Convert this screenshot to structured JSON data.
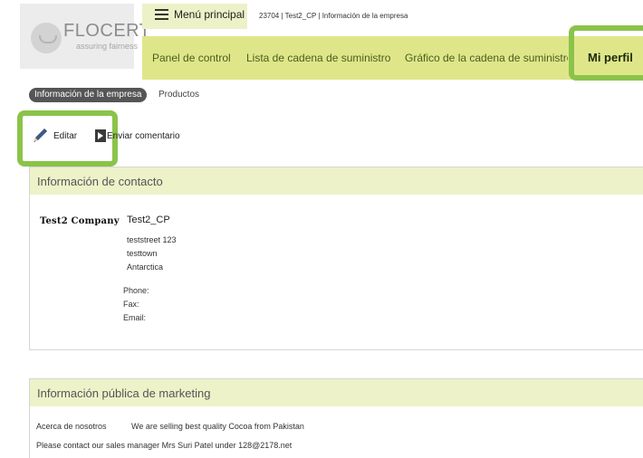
{
  "brand": {
    "name": "FLOCERT",
    "tagline": "assuring fairness"
  },
  "header": {
    "menu_label": "Menú principal",
    "breadcrumb": "23704 | Test2_CP | Información de la empresa"
  },
  "nav": {
    "items": [
      "Panel de control",
      "Lista de cadena de suministro",
      "Gráfico de la cadena de suministro"
    ],
    "active": "Mi perfil"
  },
  "tabs": {
    "active": "Información de la empresa",
    "other": "Productos"
  },
  "actions": {
    "edit": "Editar",
    "comment": "Enviar comentario"
  },
  "contact": {
    "title": "Información de contacto",
    "logo_text": "Test2 Company",
    "company": "Test2_CP",
    "address": [
      "teststreet 123",
      "testtown",
      "Antarctica"
    ],
    "phone_label": "Phone:",
    "fax_label": "Fax:",
    "email_label": "Email:"
  },
  "marketing": {
    "title": "Información pública de marketing",
    "about_label": "Acerca de nosotros",
    "about_value": "We are selling best quality Cocoa from Pakistan",
    "contact_line": "Please contact our sales manager Mrs Suri Patel under 128@2178.net"
  },
  "colors": {
    "nav_bg": "#dfe68a",
    "highlight": "#8bc34a",
    "panel_head": "#eef2c9"
  }
}
